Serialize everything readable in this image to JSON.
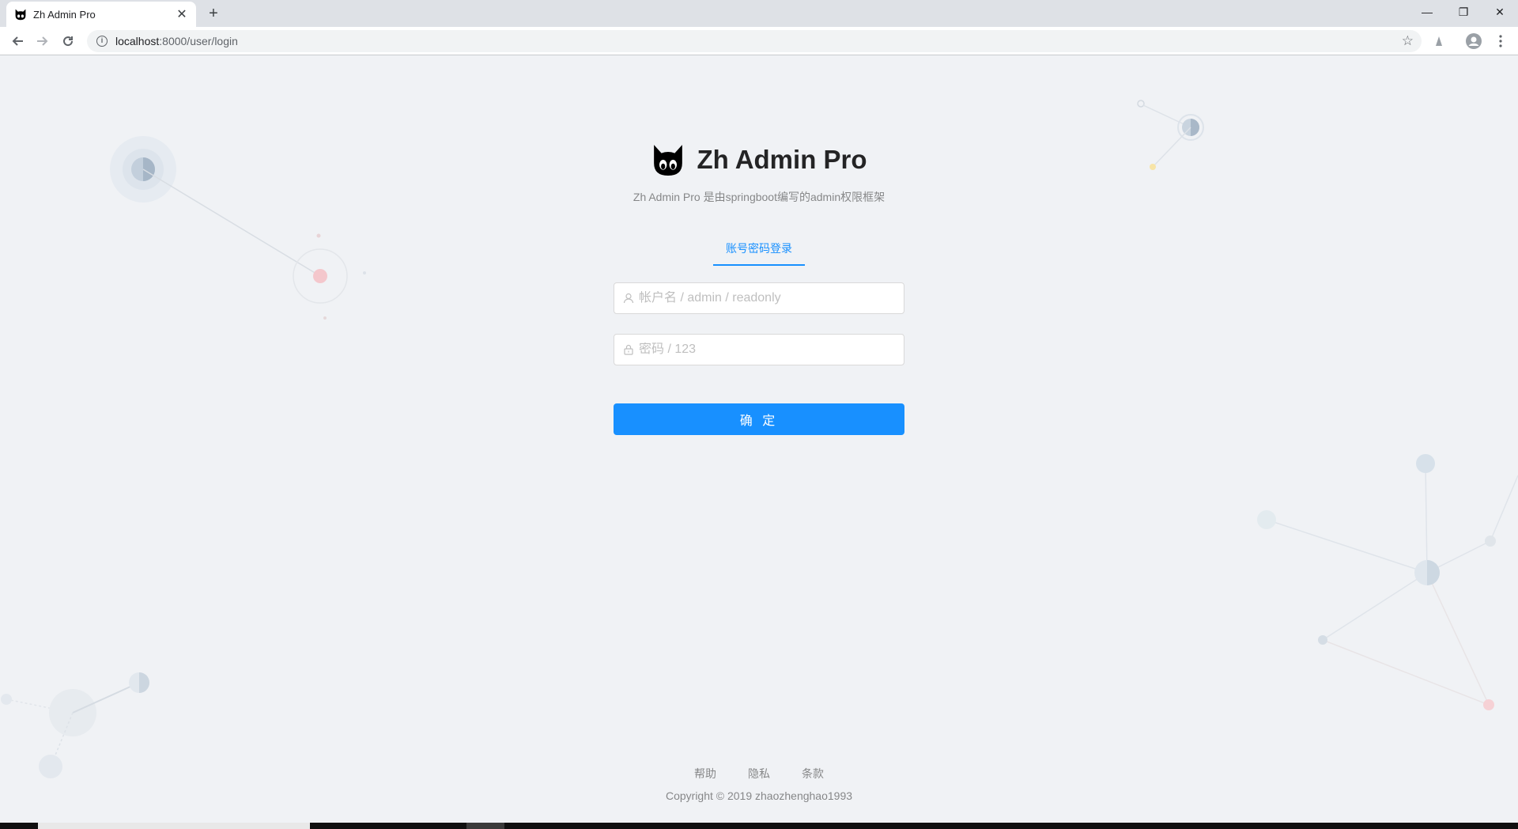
{
  "browser": {
    "tab_title": "Zh Admin Pro",
    "url_host": "localhost",
    "url_path": ":8000/user/login"
  },
  "login": {
    "title": "Zh Admin Pro",
    "subtitle": "Zh Admin Pro 是由springboot编写的admin权限框架",
    "tab_label": "账号密码登录",
    "username_placeholder": "帐户名 / admin / readonly",
    "password_placeholder": "密码 / 123",
    "submit_label": "确 定"
  },
  "footer": {
    "links": [
      "帮助",
      "隐私",
      "条款"
    ],
    "copyright": "Copyright © 2019 zhaozhenghao1993"
  },
  "colors": {
    "primary": "#1890ff",
    "background": "#f0f2f5"
  },
  "icons": [
    "cat-logo-icon",
    "user-icon",
    "lock-icon",
    "info-icon",
    "star-icon",
    "back-icon",
    "forward-icon",
    "reload-icon"
  ]
}
